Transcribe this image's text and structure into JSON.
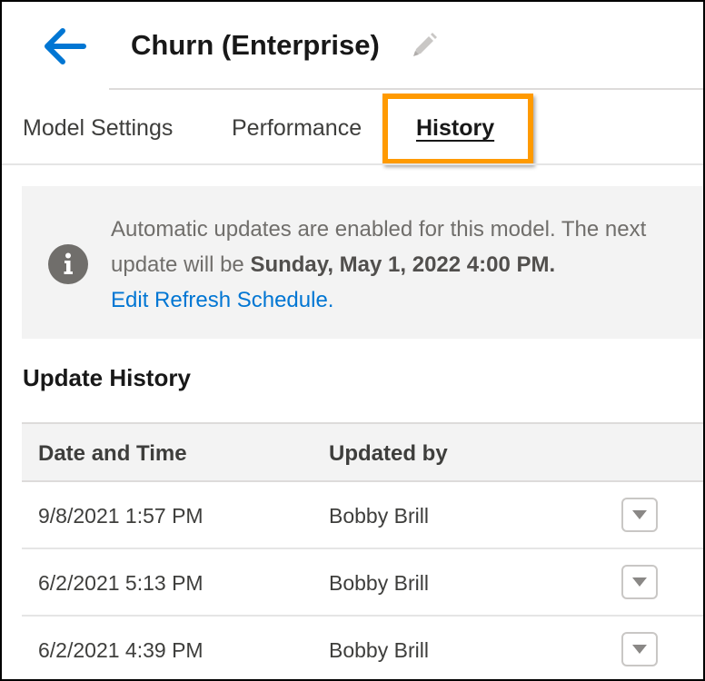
{
  "header": {
    "title": "Churn (Enterprise)",
    "back_icon": "arrow-left-icon",
    "edit_icon": "pencil-icon",
    "accent_color": "#0176d3"
  },
  "tabs": [
    {
      "label": "Model Settings",
      "active": false
    },
    {
      "label": "Performance",
      "active": false
    },
    {
      "label": "History",
      "active": true
    }
  ],
  "highlight_color": "#ff9a00",
  "notice": {
    "icon": "info-icon",
    "text_before": "Automatic updates are enabled for this model. The next update will be ",
    "next_update": "Sunday, May 1, 2022 4:00 PM.",
    "link_label": "Edit Refresh Schedule."
  },
  "history": {
    "title": "Update History",
    "columns": [
      "Date and Time",
      "Updated by"
    ],
    "rows": [
      {
        "date": "9/8/2021 1:57 PM",
        "user": "Bobby Brill"
      },
      {
        "date": "6/2/2021 5:13 PM",
        "user": "Bobby Brill"
      },
      {
        "date": "6/2/2021 4:39 PM",
        "user": "Bobby Brill"
      }
    ],
    "row_action_icon": "chevron-down-icon"
  }
}
